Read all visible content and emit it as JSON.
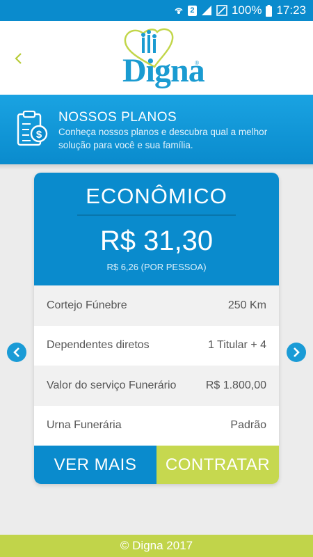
{
  "status_bar": {
    "sim_badge": "2",
    "battery_percent": "100%",
    "time": "17:23",
    "icons": [
      "hotspot-icon",
      "sim-icon",
      "signal-icon",
      "no-sim-icon",
      "battery-icon"
    ]
  },
  "header": {
    "back_icon": "chevron-left-icon",
    "logo_text": "Digna",
    "logo_registered": "®"
  },
  "banner": {
    "icon": "clipboard-money-icon",
    "title": "NOSSOS PLANOS",
    "description": "Conheça nossos planos e descubra qual a melhor solução para você e sua família."
  },
  "plan": {
    "name": "ECONÔMICO",
    "price": "R$ 31,30",
    "price_per_person": "R$ 6,26 (POR PESSOA)",
    "rows": [
      {
        "label": "Cortejo Fúnebre",
        "value": "250 Km"
      },
      {
        "label": "Dependentes diretos",
        "value": "1 Titular + 4"
      },
      {
        "label": "Valor do serviço Funerário",
        "value": "R$ 1.800,00"
      },
      {
        "label": "Urna Funerária",
        "value": "Padrão"
      }
    ],
    "more_label": "VER MAIS",
    "buy_label": "CONTRATAR"
  },
  "carousel": {
    "prev_icon": "chevron-left-circle-icon",
    "next_icon": "chevron-right-circle-icon"
  },
  "footer": {
    "text": "© Digna 2017"
  },
  "colors": {
    "primary_blue": "#0a8bcd",
    "accent_green": "#c6d84f",
    "footer_green": "#c1d44a",
    "background": "#ececec"
  }
}
